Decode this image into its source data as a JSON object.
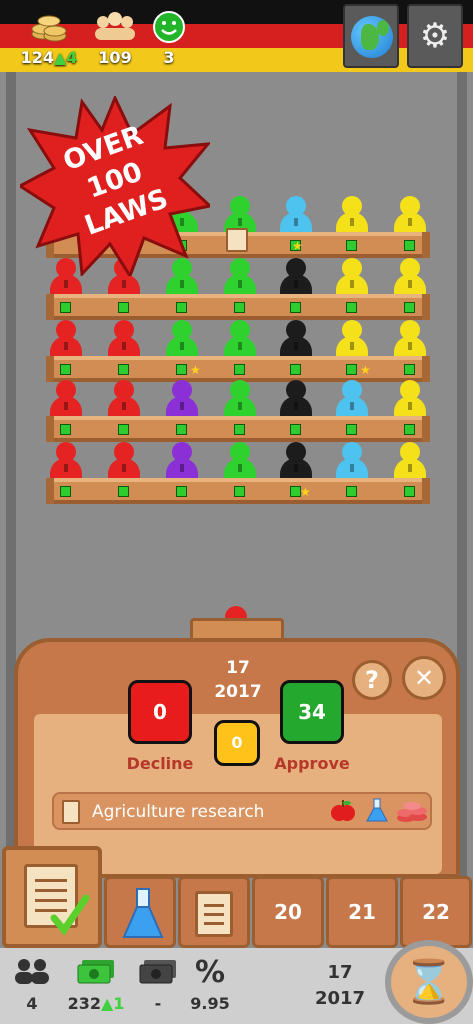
{
  "top": {
    "coins": "124",
    "coins_delta": "4",
    "people": "109",
    "happiness": "3"
  },
  "icons": {
    "coins": "coins-icon",
    "people": "crowd-icon",
    "happiness": "smiley-icon",
    "globe": "globe-icon",
    "settings": "gears-icon",
    "hourglass": "hourglass-icon"
  },
  "promo": {
    "line1": "OVER",
    "line2": "100",
    "line3": "LAWS"
  },
  "vote": {
    "turn": "17",
    "year": "2017",
    "decline_count": "0",
    "abstain_count": "0",
    "approve_count": "34",
    "decline_label": "Decline",
    "approve_label": "Approve",
    "help_label": "?",
    "close_label": "✕"
  },
  "law": {
    "name": "Agriculture research"
  },
  "tabs": [
    "20",
    "21",
    "22"
  ],
  "bottom": {
    "population": "4",
    "money": "232",
    "money_delta": "1",
    "debt": "-",
    "rate_symbol": "%",
    "rate": "9.95",
    "turn": "17",
    "year": "2017"
  },
  "colors": {
    "red": "#e52323",
    "green": "#2fd12f",
    "cyan": "#4fc3f0",
    "yellow": "#f5e11a",
    "black": "#1c1c1c",
    "purple": "#8b2fd6",
    "decline": "#e81c1c",
    "abstain": "#ffc21a",
    "approve": "#25a82e"
  }
}
